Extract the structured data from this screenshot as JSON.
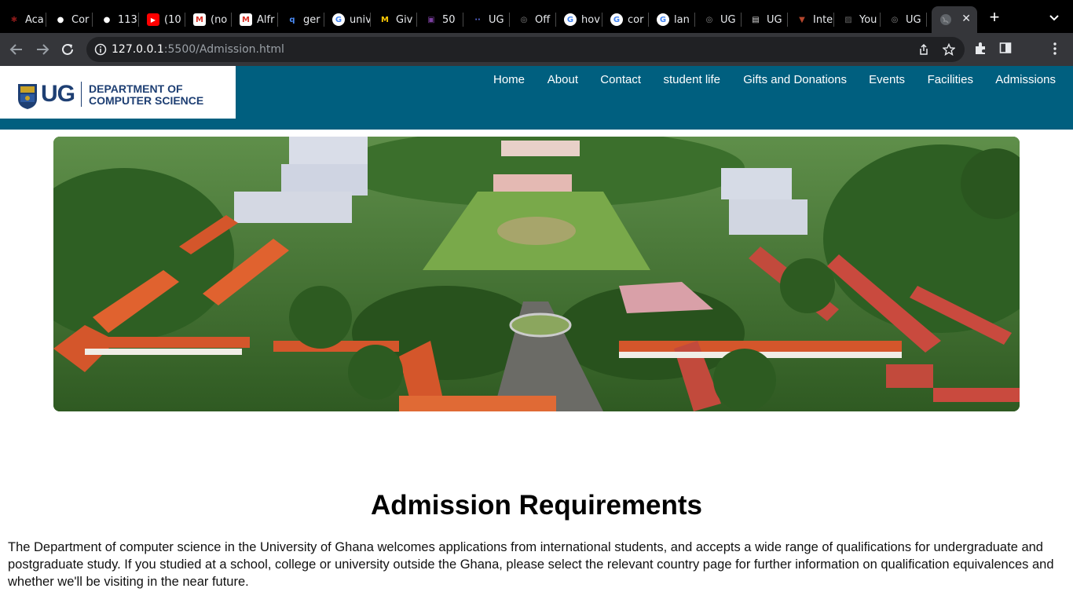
{
  "browser": {
    "tabs": [
      {
        "label": "Aca",
        "icon": "academic-icon",
        "fav_color": "#8b1a1a"
      },
      {
        "label": "Cor",
        "icon": "github-icon",
        "fav_color": "#ffffff"
      },
      {
        "label": "113",
        "icon": "github-icon",
        "fav_color": "#ffffff"
      },
      {
        "label": "(10",
        "icon": "youtube-icon",
        "fav_color": "#ff0000"
      },
      {
        "label": "(no",
        "icon": "gmail-icon",
        "fav_color": "#d93025"
      },
      {
        "label": "Alfr",
        "icon": "gmail-icon",
        "fav_color": "#d93025"
      },
      {
        "label": "ger",
        "icon": "search-icon",
        "fav_color": "#4a8af4"
      },
      {
        "label": "univ",
        "icon": "google-icon",
        "fav_color": "#4285f4"
      },
      {
        "label": "Giv",
        "icon": "michigan-icon",
        "fav_color": "#ffcb05"
      },
      {
        "label": "50",
        "icon": "app-icon",
        "fav_color": "#7b3fa0"
      },
      {
        "label": "UG",
        "icon": "dots-icon",
        "fav_color": "#5a6bd8"
      },
      {
        "label": "Off",
        "icon": "globe-icon",
        "fav_color": "#888888"
      },
      {
        "label": "hov",
        "icon": "google-icon",
        "fav_color": "#4285f4"
      },
      {
        "label": "cor",
        "icon": "google-icon",
        "fav_color": "#4285f4"
      },
      {
        "label": "lan",
        "icon": "google-icon",
        "fav_color": "#4285f4"
      },
      {
        "label": "UG",
        "icon": "globe-icon",
        "fav_color": "#888888"
      },
      {
        "label": "UG",
        "icon": "page-icon",
        "fav_color": "#dddddd"
      },
      {
        "label": "Inte",
        "icon": "crest-icon",
        "fav_color": "#b5462d"
      },
      {
        "label": "You",
        "icon": "image-icon",
        "fav_color": "#666666"
      },
      {
        "label": "UG",
        "icon": "globe-icon",
        "fav_color": "#888888"
      }
    ],
    "active_tab_icon": "globe-icon",
    "url_host": "127.0.0.1",
    "url_rest": ":5500/Admission.html"
  },
  "site": {
    "logo_letters": "UG",
    "dept_line1": "DEPARTMENT OF",
    "dept_line2": "COMPUTER SCIENCE",
    "nav": [
      "Home",
      "About",
      "Contact",
      "student life",
      "Gifts and Donations",
      "Events",
      "Facilities",
      "Admissions"
    ],
    "header_color": "#005f7f",
    "brand_color": "#1e3f73"
  },
  "main": {
    "title": "Admission Requirements",
    "intro": "The Department of computer science in the University of Ghana welcomes applications from international students, and accepts a wide range of qualifications for undergraduate and postgraduate study. If you studied at a school, college or university outside the Ghana, please select the relevant country page for further information on qualification equivalences and whether we'll be visiting in the near future."
  }
}
